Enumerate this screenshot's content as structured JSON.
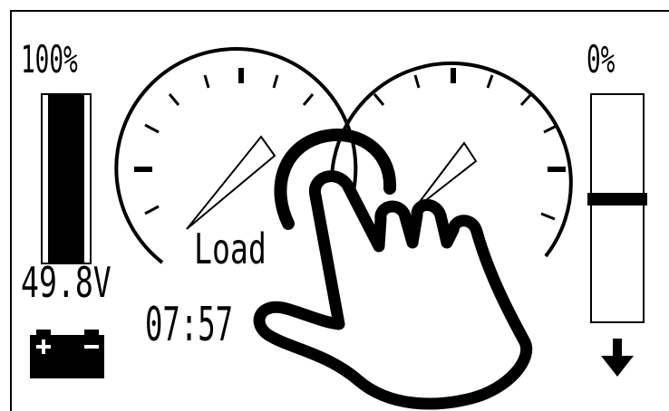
{
  "battery": {
    "percent_label": "100%",
    "voltage_label": "49.8V",
    "level": 1.0,
    "icon": "battery-icon"
  },
  "gauges": {
    "left_label": "Load",
    "right_label": ""
  },
  "clock": {
    "time_label": "07:57"
  },
  "right_meter": {
    "percent_label": "0%",
    "level": 0.0,
    "arrow_icon": "arrow-down-icon"
  },
  "overlay": {
    "icon": "tap-hand-icon"
  },
  "colors": {
    "ink": "#000000",
    "background": "#ffffff"
  }
}
